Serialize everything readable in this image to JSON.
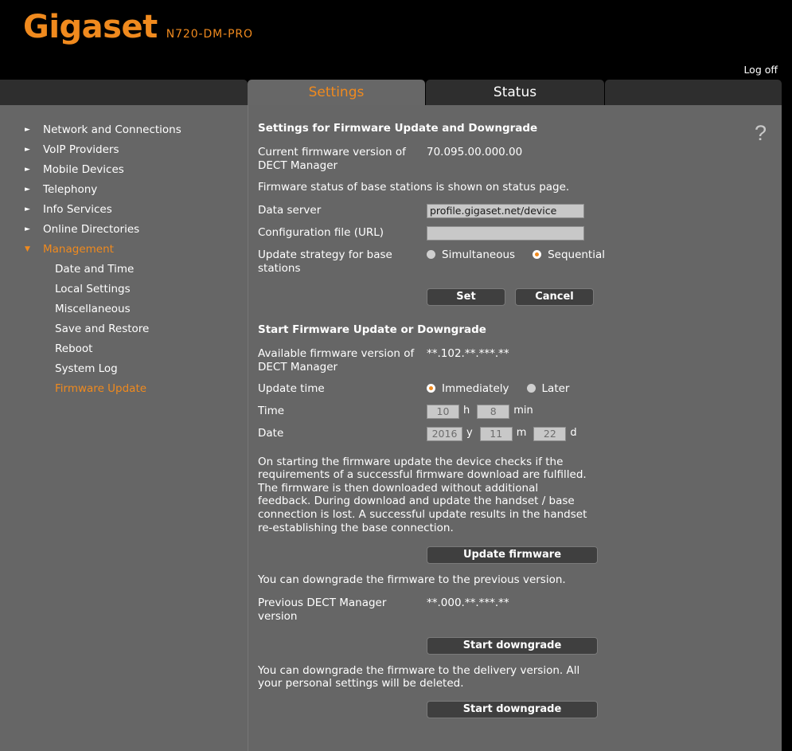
{
  "header": {
    "brand": "Gigaset",
    "model": "N720-DM-PRO",
    "logoff_label": "Log off",
    "brand_color": "#f08a1e"
  },
  "tabs": [
    {
      "label": "Settings",
      "active": true
    },
    {
      "label": "Status",
      "active": false
    },
    {
      "label": "",
      "active": false
    }
  ],
  "sidebar": {
    "items": [
      {
        "label": "Network and Connections",
        "arrow": "collapsed-arrow-icon",
        "active": false
      },
      {
        "label": "VoIP Providers",
        "arrow": "collapsed-arrow-icon",
        "active": false
      },
      {
        "label": "Mobile Devices",
        "arrow": "collapsed-arrow-icon",
        "active": false
      },
      {
        "label": "Telephony",
        "arrow": "collapsed-arrow-icon",
        "active": false
      },
      {
        "label": "Info Services",
        "arrow": "collapsed-arrow-icon",
        "active": false
      },
      {
        "label": "Online Directories",
        "arrow": "collapsed-arrow-icon",
        "active": false
      },
      {
        "label": "Management",
        "arrow": "expanded-arrow-icon",
        "active": true
      }
    ],
    "sub_items": [
      {
        "label": "Date and Time",
        "active": false
      },
      {
        "label": "Local Settings",
        "active": false
      },
      {
        "label": "Miscellaneous",
        "active": false
      },
      {
        "label": "Save and Restore",
        "active": false
      },
      {
        "label": "Reboot",
        "active": false
      },
      {
        "label": "System Log",
        "active": false
      },
      {
        "label": "Firmware Update",
        "active": true
      }
    ]
  },
  "content": {
    "help_icon": "?",
    "settings_section": {
      "title": "Settings for Firmware Update and Downgrade",
      "current_version_label": "Current firmware version of DECT Manager",
      "current_version_value": "70.095.00.000.00",
      "status_note": "Firmware status of base stations is shown on status page.",
      "data_server_label": "Data server",
      "data_server_value": "profile.gigaset.net/device",
      "config_url_label": "Configuration file (URL)",
      "config_url_value": "",
      "config_url_placeholder": "",
      "update_strategy_label": "Update strategy for base stations",
      "update_strategy_options": [
        {
          "label": "Simultaneous",
          "selected": false
        },
        {
          "label": "Sequential",
          "selected": true
        }
      ],
      "set_label": "Set",
      "cancel_label": "Cancel"
    },
    "start_section": {
      "title": "Start Firmware Update or Downgrade",
      "available_version_label": "Available firmware version of DECT Manager",
      "available_version_value": "**.102.**.***.**",
      "update_time_label": "Update time",
      "update_time_options": [
        {
          "label": "Immediately",
          "selected": true
        },
        {
          "label": "Later",
          "selected": false
        }
      ],
      "time_label": "Time",
      "time_hour": "10",
      "time_hour_unit": "h",
      "time_minute": "8",
      "time_minute_unit": "min",
      "date_label": "Date",
      "date_year": "2016",
      "date_year_unit": "y",
      "date_month": "11",
      "date_month_unit": "m",
      "date_day": "22",
      "date_day_unit": "d",
      "info_paragraph": "On starting the firmware update the device checks if the requirements of a successful firmware download are fulfilled. The firmware is then downloaded without additional feedback. During download and update the handset / base connection is lost. A successful update results in the handset re-establishing the base connection.",
      "update_firmware_label": "Update firmware",
      "downgrade_previous_note": "You can downgrade the firmware to the previous version.",
      "previous_version_label": "Previous DECT Manager version",
      "previous_version_value": "**.000.**.***.**",
      "downgrade_previous_label": "Start downgrade",
      "downgrade_delivery_note": "You can downgrade the firmware to the delivery version. All your personal settings will be deleted.",
      "downgrade_delivery_label": "Start downgrade"
    }
  }
}
